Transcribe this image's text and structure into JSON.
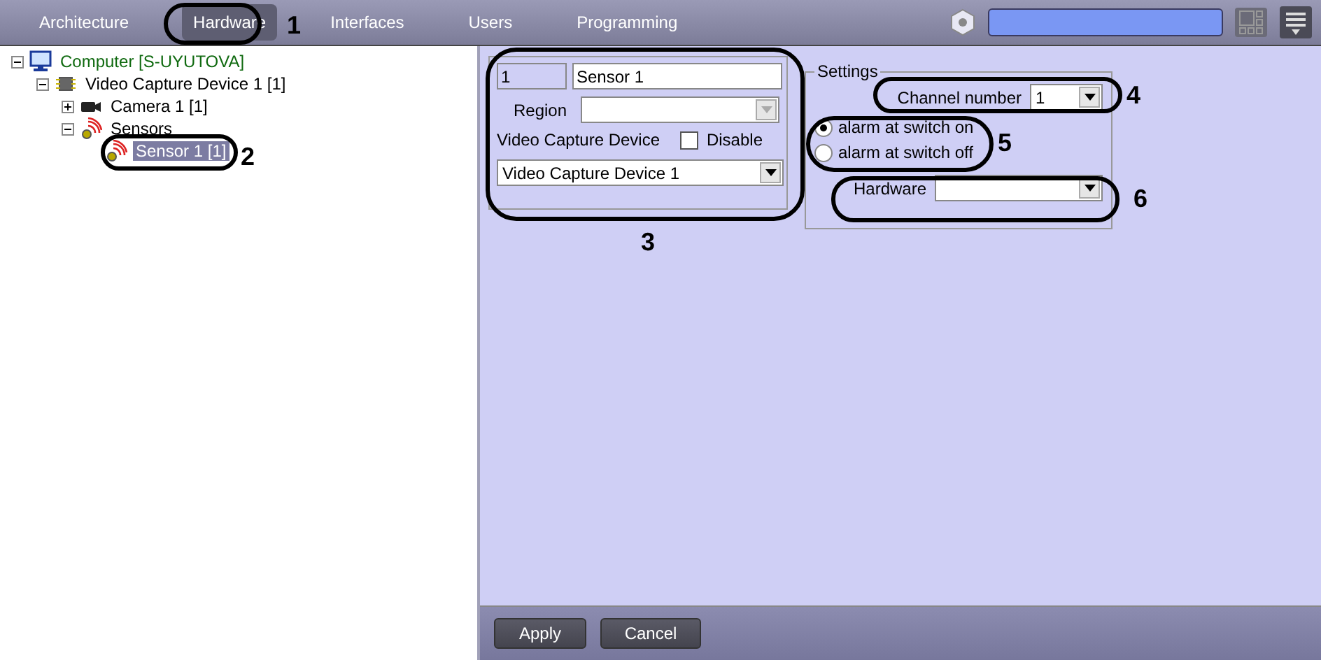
{
  "tabs": [
    {
      "label": "Architecture",
      "selected": false
    },
    {
      "label": "Hardware",
      "selected": true
    },
    {
      "label": "Interfaces",
      "selected": false
    },
    {
      "label": "Users",
      "selected": false
    },
    {
      "label": "Programming",
      "selected": false
    }
  ],
  "tree": [
    {
      "label": "Computer [S-UYUTOVA]",
      "kind": "computer",
      "expanded": true,
      "selected": false,
      "children": [
        {
          "label": "Video Capture Device 1 [1]",
          "kind": "board",
          "expanded": true,
          "selected": false,
          "children": [
            {
              "label": "Camera 1 [1]",
              "kind": "camera",
              "expanded": false,
              "selected": false
            },
            {
              "label": "Sensors",
              "kind": "sensor",
              "expanded": true,
              "selected": false,
              "children": [
                {
                  "label": "Sensor 1 [1]",
                  "kind": "sensor",
                  "selected": true
                }
              ]
            }
          ]
        }
      ]
    }
  ],
  "object": {
    "id": "1",
    "name": "Sensor 1",
    "region_label": "Region",
    "device_label": "Video Capture Device",
    "disable": {
      "label": "Disable",
      "checked": false
    },
    "device": "Video Capture Device 1"
  },
  "settings": {
    "title": "Settings",
    "channel_label": "Channel number",
    "channel": "1",
    "alarm_options": [
      {
        "label": "alarm at switch on",
        "selected": true
      },
      {
        "label": "alarm at switch off",
        "selected": false
      }
    ],
    "hardware_label": "Hardware"
  },
  "buttons": [
    "Apply",
    "Cancel"
  ],
  "callouts": [
    "1",
    "2",
    "3",
    "4",
    "5",
    "6"
  ]
}
